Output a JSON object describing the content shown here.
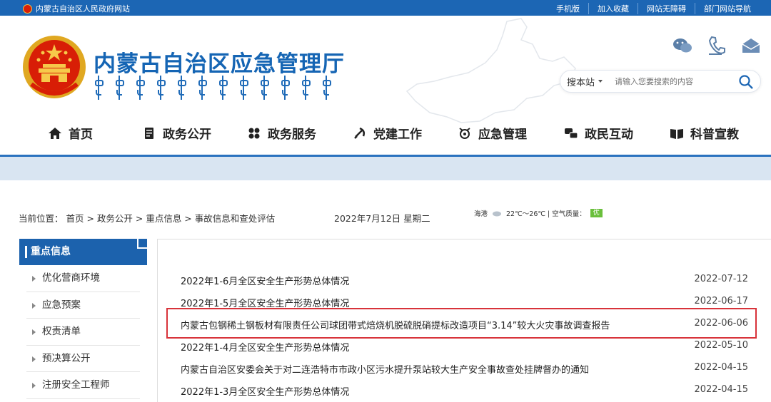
{
  "topbar": {
    "site_name": "内蒙古自治区人民政府网站",
    "links": [
      "手机版",
      "加入收藏",
      "网站无障碍",
      "部门网站导航"
    ]
  },
  "header": {
    "title": "内蒙古自治区应急管理厅",
    "icons": [
      "wechat-icon",
      "phone-icon",
      "mail-icon"
    ]
  },
  "search": {
    "scope_label": "搜本站",
    "placeholder": "请输入您要搜索的内容"
  },
  "nav": {
    "items": [
      {
        "label": "首页",
        "icon": "home-icon"
      },
      {
        "label": "政务公开",
        "icon": "document-icon"
      },
      {
        "label": "政务服务",
        "icon": "grid-icon"
      },
      {
        "label": "党建工作",
        "icon": "party-icon"
      },
      {
        "label": "应急管理",
        "icon": "emergency-icon"
      },
      {
        "label": "政民互动",
        "icon": "interaction-icon"
      },
      {
        "label": "科普宣教",
        "icon": "book-icon"
      }
    ]
  },
  "location": {
    "crumbs": "当前位置：  首页 > 政务公开 > 重点信息 > 事故信息和查处评估",
    "date": "2022年7月12日 星期二",
    "weather_city": "海港",
    "weather_temp": "22℃～26℃ | 空气质量：",
    "aqi": "优"
  },
  "sidebar": {
    "heading": "重点信息",
    "items": [
      "优化营商环境",
      "应急预案",
      "权责清单",
      "预决算公开",
      "注册安全工程师"
    ]
  },
  "articles": [
    {
      "title": "2022年1-6月全区安全生产形势总体情况",
      "date": "2022-07-12"
    },
    {
      "title": "2022年1-5月全区安全生产形势总体情况",
      "date": "2022-06-17"
    },
    {
      "title": "内蒙古包钢稀土钢板材有限责任公司球团带式焙烧机脱硫脱硝提标改造项目“3.14”较大火灾事故调查报告",
      "date": "2022-06-06"
    },
    {
      "title": "2022年1-4月全区安全生产形势总体情况",
      "date": "2022-05-10"
    },
    {
      "title": "内蒙古自治区安委会关于对二连浩特市市政小区污水提升泵站较大生产安全事故查处挂牌督办的通知",
      "date": "2022-04-15"
    },
    {
      "title": "2022年1-3月全区安全生产形势总体情况",
      "date": "2022-04-15"
    }
  ],
  "colors": {
    "brand_blue": "#1c66b4",
    "nav_line": "#2a72bf",
    "highlight_red": "#d8333a"
  }
}
